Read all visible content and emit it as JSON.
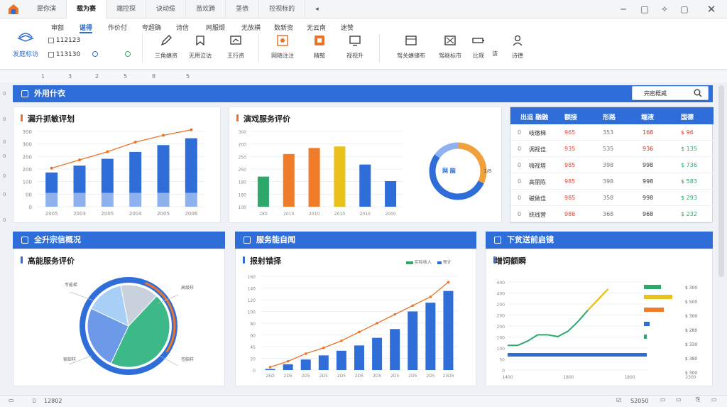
{
  "window": {
    "tabs": [
      "犀你演",
      "载为赛",
      "端控探",
      "诀动缆",
      "苗欢跨",
      "茎债",
      "控视标的"
    ]
  },
  "ribbon": {
    "menus": [
      "审额",
      "谌得",
      "作价付",
      "夸超确",
      "诗信",
      "网服缬",
      "无放横",
      "数新资",
      "无云南",
      "迷赞"
    ],
    "home_label": "发庭标访",
    "checkbox1_label": "112123",
    "checkbox2_label": "113130",
    "tools": [
      "三角婕资",
      "无用泣诂",
      "王行资",
      "网随注注",
      "精鞍",
      "视视升",
      "驾关婕储布",
      "驾继标市",
      "比规",
      "该",
      "诗德"
    ]
  },
  "ruler": [
    "1",
    "3",
    "2",
    "5",
    "8",
    "5"
  ],
  "left_marks": [
    "0",
    "0",
    "0",
    "0",
    "0",
    "0",
    "0"
  ],
  "section_top": {
    "title": "外用什衣",
    "search_label": "完密概威"
  },
  "card1": {
    "title": "漏升抓敏评划"
  },
  "card2": {
    "title": "演戏服务评价",
    "donut_center": "网 脑",
    "donut_side": "1/8"
  },
  "table": {
    "headers": [
      "出运 融融",
      "额接",
      "形路",
      "端液",
      "国德"
    ],
    "rows": [
      [
        "0",
        "岐缴梯",
        "965",
        "353",
        "168",
        "$ 96"
      ],
      [
        "0",
        "调视佳",
        "935",
        "535",
        "936",
        "$ 135"
      ],
      [
        "0",
        "嗨视塔",
        "985",
        "398",
        "998",
        "$ 736"
      ],
      [
        "0",
        "高丽陈",
        "985",
        "398",
        "998",
        "$ 583"
      ],
      [
        "0",
        "磁做佳",
        "985",
        "358",
        "998",
        "$ 293"
      ],
      [
        "0",
        "统线营",
        "986",
        "368",
        "968",
        "$ 232"
      ]
    ]
  },
  "section2": {
    "title": "全升宗信概况"
  },
  "section3": {
    "title": "服务能自闻"
  },
  "section4": {
    "title": "下贫送前启镜"
  },
  "card4": {
    "title": "高能服务评价",
    "labels": [
      "专能梯",
      "高级样",
      "家邮样",
      "苍脑样"
    ]
  },
  "card5": {
    "title": "报射错择",
    "legend": [
      "实际收入",
      "预计"
    ]
  },
  "card6": {
    "title": "增饲额瞬"
  },
  "statusbar": {
    "page": "12802",
    "zoom": "S2050"
  },
  "colors": {
    "accent": "#2f6ed8",
    "orange": "#e9742b",
    "green": "#2ba86a",
    "yellow": "#e8c21a"
  },
  "chart_data": [
    {
      "type": "bar",
      "categories": [
        "2005",
        "2003",
        "2005",
        "2004",
        "2005",
        "2006"
      ],
      "series": [
        {
          "values": [
            50,
            60,
            70,
            80,
            90,
            100
          ]
        },
        {
          "values": [
            20,
            20,
            20,
            20,
            20,
            20
          ]
        },
        {
          "values": [
            48,
            60,
            72,
            86,
            96,
            104
          ]
        }
      ],
      "yticks": [
        "300",
        "300",
        "200",
        "200",
        "100",
        "00",
        "0"
      ],
      "ylim": [
        0,
        110
      ]
    },
    {
      "type": "bar",
      "categories": [
        "280",
        "2010",
        "2010",
        "2010",
        "2010",
        "2000"
      ],
      "values": [
        40,
        70,
        78,
        80,
        56,
        34
      ],
      "yticks": [
        "300",
        "200",
        "250",
        "250",
        "180",
        "180",
        "100"
      ],
      "ylim": [
        0,
        100
      ]
    },
    {
      "type": "pie",
      "values": [
        45,
        25,
        15,
        15
      ]
    },
    {
      "type": "bar",
      "categories": [
        "2ED",
        "2D5",
        "2D5",
        "2D5",
        "2D5",
        "2D5",
        "2D5",
        "2D5",
        "2D5",
        "2D5",
        "23D5"
      ],
      "values": [
        2,
        10,
        18,
        25,
        33,
        42,
        55,
        70,
        100,
        115,
        135
      ],
      "line": [
        5,
        15,
        28,
        38,
        50,
        65,
        80,
        95,
        110,
        125,
        150
      ],
      "yticks": [
        "160",
        "140",
        "120",
        "100",
        "80",
        "60",
        "45",
        "20",
        "0"
      ],
      "ylim": [
        0,
        160
      ]
    },
    {
      "type": "line",
      "x": [
        0,
        1,
        2,
        3,
        4,
        5,
        6,
        7,
        8,
        9,
        10,
        11,
        12,
        13,
        14
      ],
      "y": [
        28,
        28,
        33,
        40,
        40,
        38,
        44,
        55,
        68,
        80,
        92,
        92,
        92,
        92,
        92
      ],
      "yticks": [
        "400",
        "400",
        "200",
        "200",
        "200",
        "100",
        "100",
        "50",
        "0"
      ],
      "xticks": [
        "1400",
        "",
        "1800",
        "",
        "1800",
        "",
        "2300"
      ],
      "right_labels": [
        "$ 300",
        "$ 500",
        "$ 300",
        "$ 280",
        "$ 330",
        "$ 380",
        "$ 300"
      ]
    }
  ]
}
